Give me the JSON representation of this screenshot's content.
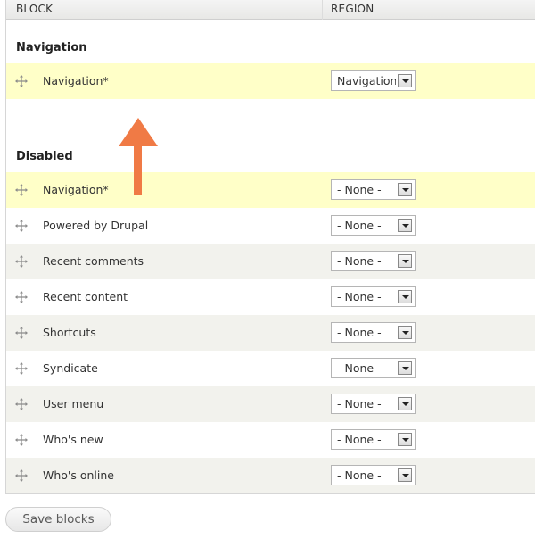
{
  "table": {
    "col_block": "BLOCK",
    "col_region": "REGION"
  },
  "sections": [
    {
      "title": "Navigation",
      "rows": [
        {
          "label": "Navigation*",
          "region": "Navigation",
          "highlighted": true
        }
      ]
    },
    {
      "title": "Disabled",
      "rows": [
        {
          "label": "Navigation*",
          "region": "- None -",
          "highlighted": true
        },
        {
          "label": "Powered by Drupal",
          "region": "- None -"
        },
        {
          "label": "Recent comments",
          "region": "- None -"
        },
        {
          "label": "Recent content",
          "region": "- None -"
        },
        {
          "label": "Shortcuts",
          "region": "- None -"
        },
        {
          "label": "Syndicate",
          "region": "- None -"
        },
        {
          "label": "User menu",
          "region": "- None -"
        },
        {
          "label": "Who's new",
          "region": "- None -"
        },
        {
          "label": "Who's online",
          "region": "- None -"
        }
      ]
    }
  ],
  "save_button": "Save blocks",
  "icons": {
    "drag_handle": "drag-handle-icon",
    "dropdown": "chevron-down-icon",
    "annotation_arrow": "up-arrow-icon"
  },
  "colors": {
    "highlight_row": "#ffffc8",
    "stripe_row": "#f2f2ed",
    "arrow": "#f07a45"
  }
}
